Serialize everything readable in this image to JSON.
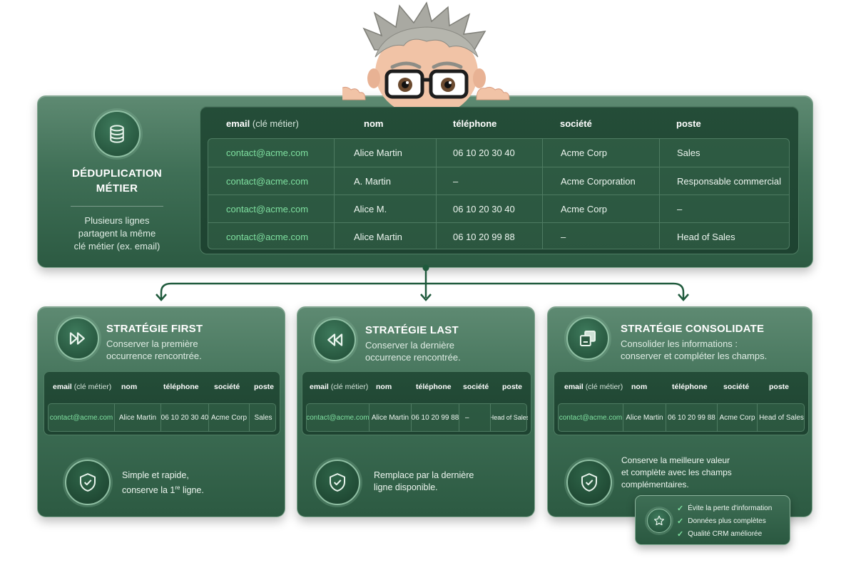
{
  "accent_color": "#7fe0a0",
  "panel_color": "#3f6f56",
  "intro": {
    "title_line1": "DÉDUPLICATION",
    "title_line2": "MÉTIER",
    "desc_line1": "Plusieurs lignes",
    "desc_line2": "partagent la même",
    "desc_line3": "clé métier (ex. email)",
    "icon": "database-icon"
  },
  "main_table": {
    "headers": {
      "email": "email",
      "email_suffix": "(clé métier)",
      "nom": "nom",
      "telephone": "téléphone",
      "societe": "société",
      "poste": "poste"
    },
    "rows": [
      {
        "email": "contact@acme.com",
        "nom": "Alice Martin",
        "telephone": "06 10 20 30 40",
        "societe": "Acme Corp",
        "poste": "Sales"
      },
      {
        "email": "contact@acme.com",
        "nom": "A. Martin",
        "telephone": "–",
        "societe": "Acme Corporation",
        "poste": "Responsable commercial"
      },
      {
        "email": "contact@acme.com",
        "nom": "Alice M.",
        "telephone": "06 10 20 30 40",
        "societe": "Acme Corp",
        "poste": "–"
      },
      {
        "email": "contact@acme.com",
        "nom": "Alice Martin",
        "telephone": "06 10 20 99 88",
        "societe": "–",
        "poste": "Head of Sales"
      }
    ]
  },
  "cards": [
    {
      "title": "STRATÉGIE FIRST",
      "sub_line1": "Conserver la première",
      "sub_line2": "occurrence rencontrée.",
      "icon": "fast-forward-icon",
      "row": {
        "email": "contact@acme.com",
        "nom": "Alice Martin",
        "telephone": "06 10 20 30 40",
        "societe": "Acme Corp",
        "poste": "Sales"
      },
      "note_line1": "Simple et rapide,",
      "note_line2_pre": "conserve la 1",
      "note_line2_sup": "re",
      "note_line2_post": " ligne."
    },
    {
      "title": "STRATÉGIE LAST",
      "sub_line1": "Conserver la dernière",
      "sub_line2": "occurrence rencontrée.",
      "icon": "rewind-icon",
      "row": {
        "email": "contact@acme.com",
        "nom": "Alice Martin",
        "telephone": "06 10 20 99 88",
        "societe": "–",
        "poste": "Head of Sales"
      },
      "note_line1": "Remplace par la dernière",
      "note_line2": "ligne disponible."
    },
    {
      "title": "STRATÉGIE CONSOLIDATE",
      "sub_line1": "Consolider les informations :",
      "sub_line2": "conserver et compléter les champs.",
      "icon": "merge-squares-icon",
      "row": {
        "email": "contact@acme.com",
        "nom": "Alice Martin",
        "telephone": "06 10 20 99 88",
        "societe": "Acme Corp",
        "poste": "Head of Sales"
      },
      "note_line1": "Conserve la meilleure valeur",
      "note_line2": "et complète avec les champs",
      "note_line3": "complémentaires."
    }
  ],
  "mini_headers": {
    "email": "email",
    "email_suffix": "(clé métier)",
    "nom": "nom",
    "telephone": "téléphone",
    "societe": "société",
    "poste": "poste"
  },
  "benefits": {
    "items": [
      "Évite la perte d'information",
      "Données plus complètes",
      "Qualité CRM améliorée"
    ],
    "icon": "star-icon"
  }
}
